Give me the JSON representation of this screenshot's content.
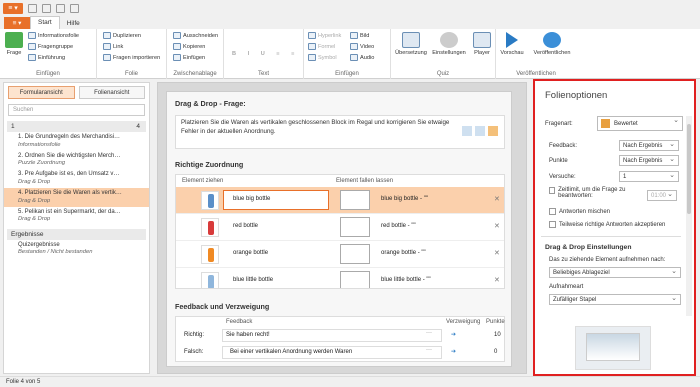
{
  "titlebar": {
    "app_label": "≡ ▾"
  },
  "tabs": [
    "Start",
    "Hilfe"
  ],
  "ribbon": {
    "groups": {
      "einfuegen": "Einfügen",
      "folie": "Folie",
      "zwischenablage": "Zwischenablage",
      "text": "Text",
      "einfuegen2": "Einfügen",
      "quiz": "Quiz",
      "veroeffentlichen": "Veröffentlichen"
    },
    "frage": "Frage",
    "informationsfolie": "Informationsfolie",
    "fragengruppe": "Fragengruppe",
    "einfuehrung": "Einführung",
    "duplizieren": "Duplizieren",
    "link": "Link",
    "fragen_importieren": "Fragen importieren",
    "ausschneiden": "Ausschneiden",
    "kopieren": "Kopieren",
    "einfuegen_btn": "Einfügen",
    "hyperlink": "Hyperlink",
    "formel": "Formel",
    "symbol": "Symbol",
    "bild": "Bild",
    "video": "Video",
    "audio": "Audio",
    "uebersetzung": "Übersetzung",
    "einstellungen": "Einstellungen",
    "player": "Player",
    "vorschau": "Vorschau",
    "veroeffentlichen_btn": "Veröffentlichen"
  },
  "left": {
    "tab_form": "Formularansicht",
    "tab_folie": "Folienansicht",
    "search_placeholder": "Suchen",
    "section1": "1",
    "section1_count": "4",
    "slides": [
      {
        "title": "1. Die Grundregeln des Merchandisi…",
        "sub": "Informationsfolie"
      },
      {
        "title": "2. Ordnen Sie die wichtigsten Merch…",
        "sub": "Puzzle Zuordnung"
      },
      {
        "title": "3. Pre Aufgabe ist es, den Umsatz v…",
        "sub": "Drag & Drop"
      },
      {
        "title": "4. Platzieren Sie die Waren als vertik…",
        "sub": "Drag & Drop"
      },
      {
        "title": "5. Pelikan ist ein Supermarkt, der da…",
        "sub": "Drag & Drop"
      }
    ],
    "section2": "Ergebnisse",
    "results_title": "Quizergebnisse",
    "results_sub": "Bestanden / Nicht bestanden"
  },
  "center": {
    "question_header": "Drag & Drop - Frage:",
    "question_text": "Platzieren Sie die Waren als vertikalen geschlossenen Block im Regal und korrigieren Sie etwaige Fehler in der aktuellen Anordnung.",
    "match_header": "Richtige Zuordnung",
    "col_drag": "Element ziehen",
    "col_drop": "Element fallen lassen",
    "rows": [
      {
        "item": "blue big bottle",
        "target": "blue big bottle - \"\"",
        "color": "#5a8fc8"
      },
      {
        "item": "red bottle",
        "target": "red bottle - \"\"",
        "color": "#d83b3b"
      },
      {
        "item": "orange bottle",
        "target": "orange bottle - \"\"",
        "color": "#f08a24"
      },
      {
        "item": "blue little bottle",
        "target": "blue little bottle - \"\"",
        "color": "#8fb6dc"
      }
    ],
    "feedback_header": "Feedback und Verzweigung",
    "fb_col_feedback": "Feedback",
    "fb_col_branch": "Verzweigung",
    "fb_col_points": "Punkte",
    "fb_rows": [
      {
        "label": "Richtig:",
        "text": "Sie haben recht!",
        "points": "10"
      },
      {
        "label": "Falsch:",
        "text": "Bei einer vertikalen Anordnung werden Waren",
        "points": "0"
      }
    ]
  },
  "right": {
    "title": "Folienoptionen",
    "fragenart_label": "Fragenart:",
    "fragenart_value": "Bewertet",
    "feedback_label": "Feedback:",
    "feedback_value": "Nach Ergebnis",
    "punkte_label": "Punkte",
    "punkte_value": "Nach Ergebnis",
    "versuche_label": "Versuche:",
    "versuche_value": "1",
    "zeitlimit": "Zeitlimit, um die Frage zu beantworten:",
    "zeit_value": "01:00",
    "antworten_mischen": "Antworten mischen",
    "teilweise": "Teilweise richtige Antworten akzeptieren",
    "dd_header": "Drag & Drop Einstellungen",
    "dd_label": "Das zu ziehende Element aufnehmen nach:",
    "dd_value": "Beliebiges Ablageziel",
    "aufnahme_label": "Aufnahmeart",
    "aufnahme_value": "Zufälliger Stapel"
  },
  "status": "Folie 4 von 5",
  "colors": {
    "accent": "#e8702a",
    "highlight": "#fbd0ac",
    "red_border": "#e02020"
  }
}
